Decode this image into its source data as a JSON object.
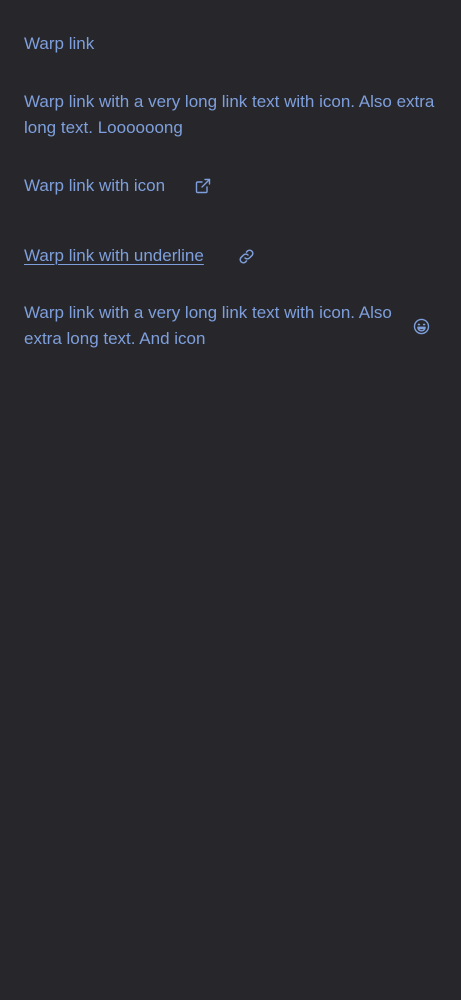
{
  "links": [
    {
      "label": "Warp link"
    },
    {
      "label": "Warp link with a very long link text with icon. Also extra long text. Loooooong"
    },
    {
      "label": "Warp link with icon",
      "icon": "external-link-icon"
    },
    {
      "label": "Warp link with underline",
      "icon": "link-icon",
      "underlined": true
    },
    {
      "label": "Warp link with a very long link text with icon. Also extra long text. And icon",
      "icon": "smile-icon"
    }
  ],
  "colors": {
    "background": "#27272b",
    "link": "#7e9fdc"
  }
}
